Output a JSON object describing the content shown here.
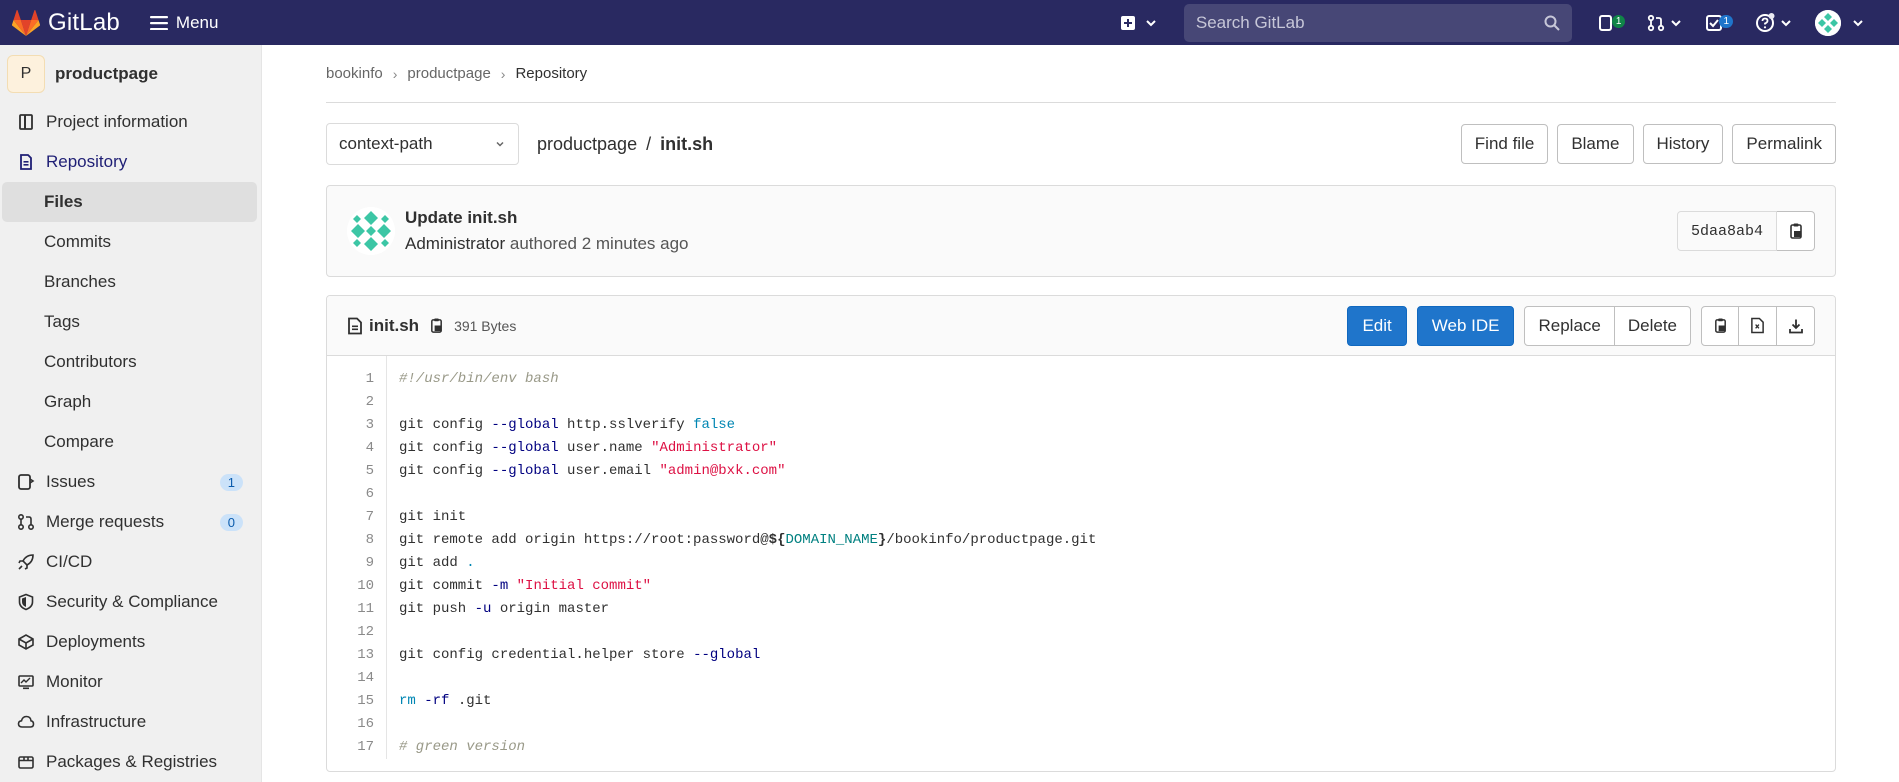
{
  "topbar": {
    "brand": "GitLab",
    "menu_label": "Menu",
    "search_placeholder": "Search GitLab",
    "issues_badge": "1",
    "todos_badge": "1"
  },
  "sidebar": {
    "project_initial": "P",
    "project_name": "productpage",
    "items": [
      {
        "label": "Project information",
        "icon": "project-info-icon"
      },
      {
        "label": "Repository",
        "icon": "repository-icon"
      },
      {
        "label": "Issues",
        "icon": "issues-icon",
        "count": "1"
      },
      {
        "label": "Merge requests",
        "icon": "merge-request-icon",
        "count": "0"
      },
      {
        "label": "CI/CD",
        "icon": "rocket-icon"
      },
      {
        "label": "Security & Compliance",
        "icon": "shield-icon"
      },
      {
        "label": "Deployments",
        "icon": "deployments-icon"
      },
      {
        "label": "Monitor",
        "icon": "monitor-icon"
      },
      {
        "label": "Infrastructure",
        "icon": "cloud-icon"
      },
      {
        "label": "Packages & Registries",
        "icon": "package-icon"
      }
    ],
    "repository_sub": [
      "Files",
      "Commits",
      "Branches",
      "Tags",
      "Contributors",
      "Graph",
      "Compare"
    ]
  },
  "breadcrumb": [
    "bookinfo",
    "productpage",
    "Repository"
  ],
  "tree": {
    "branch": "context-path",
    "path_root": "productpage",
    "path_file": "init.sh",
    "buttons": [
      "Find file",
      "Blame",
      "History",
      "Permalink"
    ]
  },
  "commit": {
    "title": "Update init.sh",
    "author": "Administrator",
    "meta": "authored 2 minutes ago",
    "sha": "5daa8ab4"
  },
  "file": {
    "name": "init.sh",
    "size": "391 Bytes",
    "edit_label": "Edit",
    "webide_label": "Web IDE",
    "replace_label": "Replace",
    "delete_label": "Delete"
  },
  "code_lines": [
    "#!/usr/bin/env bash",
    "",
    "git config --global http.sslverify false",
    "git config --global user.name \"Administrator\"",
    "git config --global user.email \"admin@bxk.com\"",
    "",
    "git init",
    "git remote add origin https://root:password@${DOMAIN_NAME}/bookinfo/productpage.git",
    "git add .",
    "git commit -m \"Initial commit\"",
    "git push -u origin master",
    "",
    "git config credential.helper store --global",
    "",
    "rm -rf .git",
    "",
    "# green version"
  ],
  "colors": {
    "nav_bg": "#292961",
    "primary": "#1f75cb",
    "logo_orange": "#e24329"
  }
}
